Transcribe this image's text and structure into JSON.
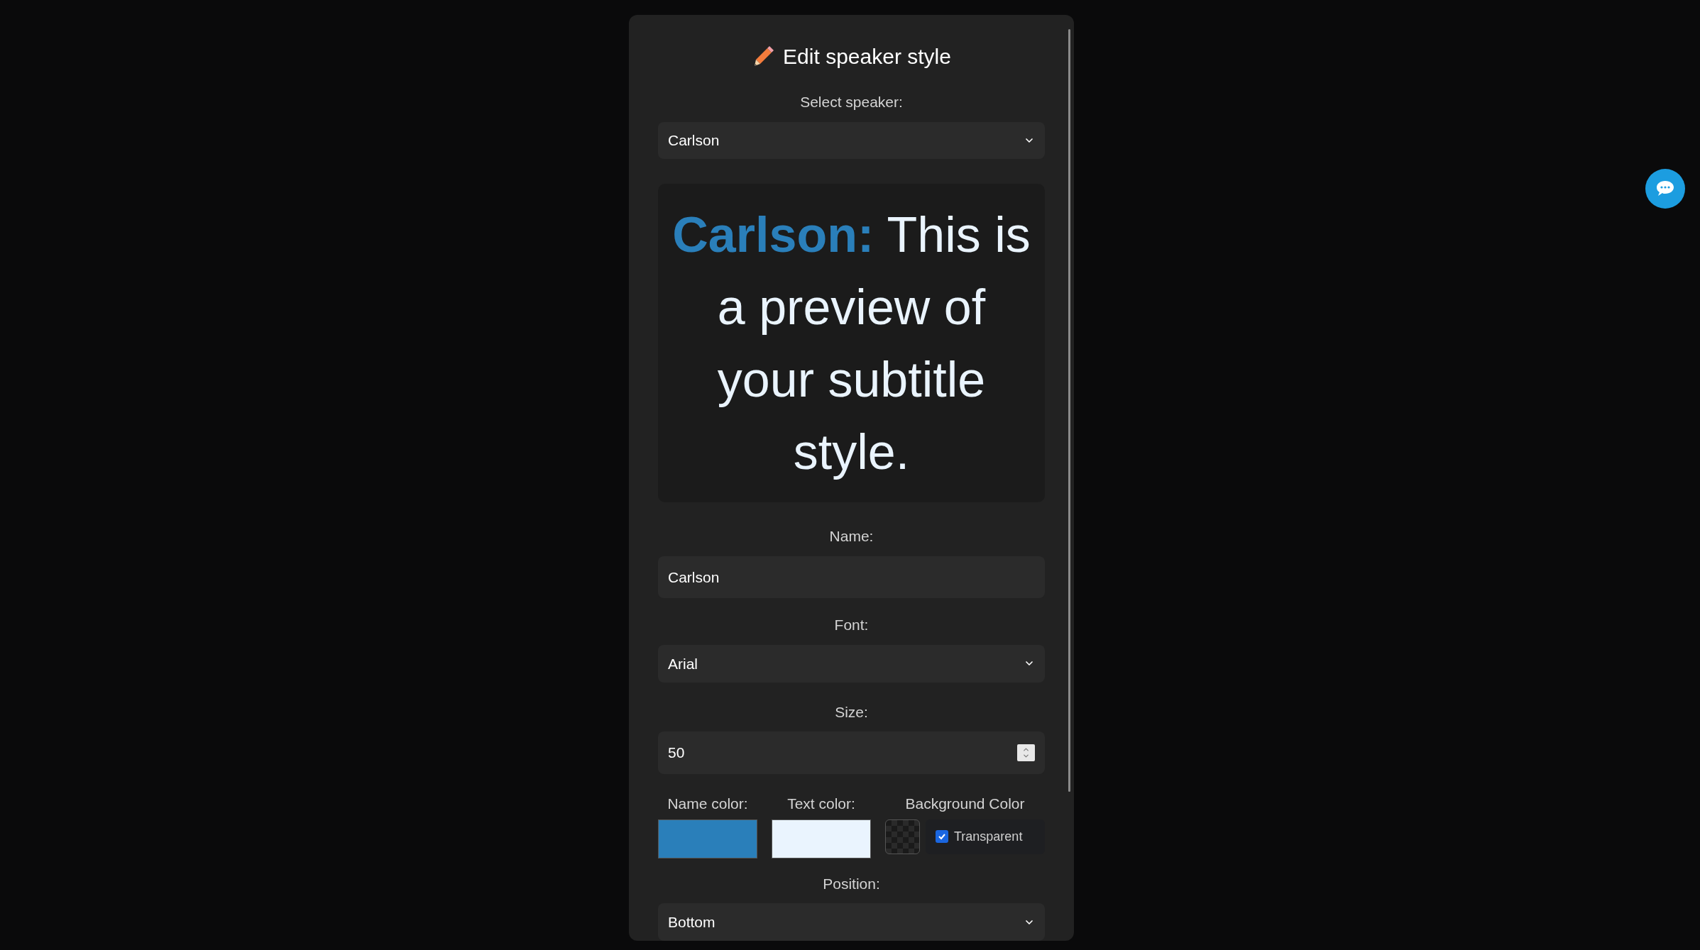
{
  "dialog": {
    "title": "Edit speaker style",
    "speaker_select": {
      "label": "Select speaker:",
      "value": "Carlson"
    },
    "preview": {
      "name": "Carlson:",
      "text": "This is a preview of your subtitle style."
    },
    "name_field": {
      "label": "Name:",
      "value": "Carlson"
    },
    "font_select": {
      "label": "Font:",
      "value": "Arial"
    },
    "size_field": {
      "label": "Size:",
      "value": "50"
    },
    "colors": [
      {
        "label": "Name color:",
        "color": "#2a7fba"
      },
      {
        "label": "Text color:",
        "color": "#eaf4fe"
      }
    ],
    "background_color": {
      "label": "Background Color",
      "transparent_label": "Transparent",
      "transparent": true
    },
    "position_select": {
      "label": "Position:",
      "value": "Bottom"
    }
  }
}
